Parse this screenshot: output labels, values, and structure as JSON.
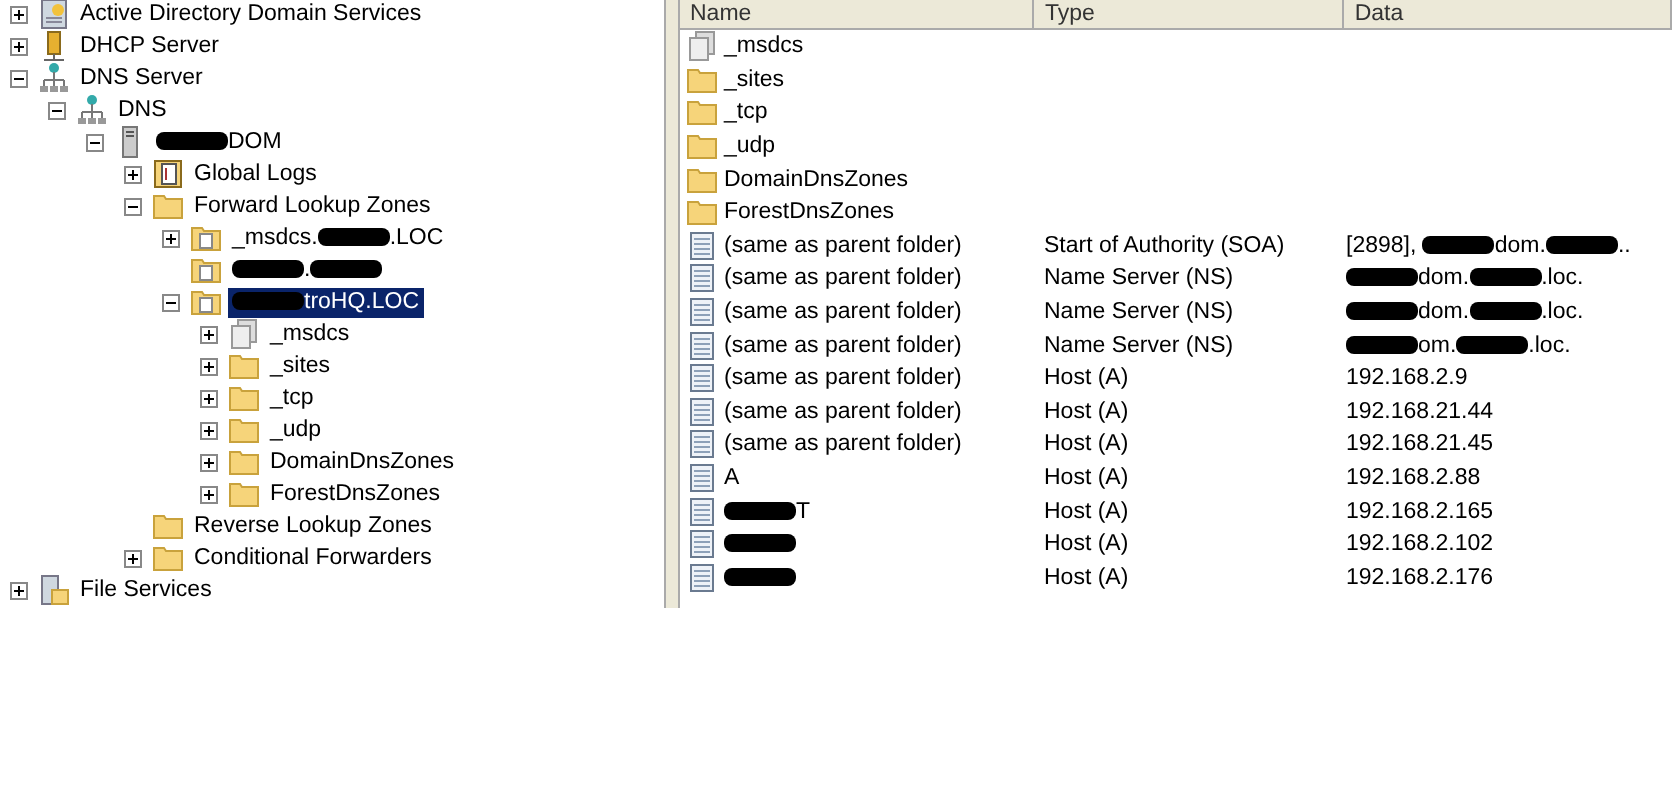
{
  "tree": [
    {
      "label": [
        {
          "text": "Active Directory Domain Services"
        }
      ],
      "kind": "roles",
      "expanded": false,
      "selected": false
    },
    {
      "label": [
        {
          "text": "DHCP Server"
        }
      ],
      "kind": "dhcp",
      "expanded": false,
      "selected": false
    },
    {
      "label": [
        {
          "text": "DNS Server"
        }
      ],
      "kind": "network",
      "expanded": true,
      "selected": false,
      "children": [
        {
          "label": [
            {
              "text": "DNS"
            }
          ],
          "kind": "network",
          "expanded": true,
          "selected": false,
          "children": [
            {
              "label": [
                {
                  "kind": "redaction"
                },
                {
                  "text": "DOM"
                }
              ],
              "kind": "server",
              "expanded": true,
              "selected": false,
              "children": [
                {
                  "label": [
                    {
                      "text": "Global Logs"
                    }
                  ],
                  "kind": "logs",
                  "expanded": false,
                  "selected": false
                },
                {
                  "label": [
                    {
                      "text": "Forward Lookup Zones"
                    }
                  ],
                  "kind": "folder",
                  "expanded": true,
                  "selected": false,
                  "children": [
                    {
                      "label": [
                        {
                          "text": "_msdcs."
                        },
                        {
                          "kind": "redaction"
                        },
                        {
                          "text": ".LOC"
                        }
                      ],
                      "kind": "zone",
                      "expanded": false,
                      "selected": false
                    },
                    {
                      "label": [
                        {
                          "kind": "redaction"
                        },
                        {
                          "text": "."
                        },
                        {
                          "kind": "redaction"
                        }
                      ],
                      "kind": "zone",
                      "selected": false
                    },
                    {
                      "label": [
                        {
                          "kind": "redaction"
                        },
                        {
                          "text": "troHQ.LOC"
                        }
                      ],
                      "kind": "zone",
                      "expanded": true,
                      "selected": true,
                      "children": [
                        {
                          "label": [
                            {
                              "text": "_msdcs"
                            }
                          ],
                          "kind": "delegation",
                          "expanded": false,
                          "selected": false
                        },
                        {
                          "label": [
                            {
                              "text": "_sites"
                            }
                          ],
                          "kind": "folder",
                          "expanded": false,
                          "selected": false
                        },
                        {
                          "label": [
                            {
                              "text": "_tcp"
                            }
                          ],
                          "kind": "folder",
                          "expanded": false,
                          "selected": false
                        },
                        {
                          "label": [
                            {
                              "text": "_udp"
                            }
                          ],
                          "kind": "folder",
                          "expanded": false,
                          "selected": false
                        },
                        {
                          "label": [
                            {
                              "text": "DomainDnsZones"
                            }
                          ],
                          "kind": "folder",
                          "expanded": false,
                          "selected": false
                        },
                        {
                          "label": [
                            {
                              "text": "ForestDnsZones"
                            }
                          ],
                          "kind": "folder",
                          "expanded": false,
                          "selected": false
                        }
                      ]
                    }
                  ]
                },
                {
                  "label": [
                    {
                      "text": "Reverse Lookup Zones"
                    }
                  ],
                  "kind": "folder",
                  "selected": false
                },
                {
                  "label": [
                    {
                      "text": "Conditional Forwarders"
                    }
                  ],
                  "kind": "folder",
                  "expanded": false,
                  "selected": false
                }
              ]
            }
          ]
        }
      ]
    },
    {
      "label": [
        {
          "text": "File Services"
        }
      ],
      "kind": "files",
      "expanded": false,
      "selected": false
    }
  ],
  "list": {
    "columns": [
      "Name",
      "Type",
      "Data"
    ],
    "rows": [
      {
        "kind": "delegation",
        "name": [
          {
            "text": "_msdcs"
          }
        ]
      },
      {
        "kind": "folder",
        "name": [
          {
            "text": "_sites"
          }
        ]
      },
      {
        "kind": "folder",
        "name": [
          {
            "text": "_tcp"
          }
        ]
      },
      {
        "kind": "folder",
        "name": [
          {
            "text": "_udp"
          }
        ]
      },
      {
        "kind": "folder",
        "name": [
          {
            "text": "DomainDnsZones"
          }
        ]
      },
      {
        "kind": "folder",
        "name": [
          {
            "text": "ForestDnsZones"
          }
        ]
      },
      {
        "kind": "record",
        "name": [
          {
            "text": "(same as parent folder)"
          }
        ],
        "type": "Start of Authority (SOA)",
        "data": [
          {
            "text": "[2898], "
          },
          {
            "kind": "redaction"
          },
          {
            "text": "dom."
          },
          {
            "kind": "redaction"
          },
          {
            "text": ".."
          }
        ]
      },
      {
        "kind": "record",
        "name": [
          {
            "text": "(same as parent folder)"
          }
        ],
        "type": "Name Server (NS)",
        "data": [
          {
            "kind": "redaction"
          },
          {
            "text": "dom."
          },
          {
            "kind": "redaction"
          },
          {
            "text": ".loc."
          }
        ]
      },
      {
        "kind": "record",
        "name": [
          {
            "text": "(same as parent folder)"
          }
        ],
        "type": "Name Server (NS)",
        "data": [
          {
            "kind": "redaction"
          },
          {
            "text": "dom."
          },
          {
            "kind": "redaction"
          },
          {
            "text": ".loc."
          }
        ]
      },
      {
        "kind": "record",
        "name": [
          {
            "text": "(same as parent folder)"
          }
        ],
        "type": "Name Server (NS)",
        "data": [
          {
            "kind": "redaction"
          },
          {
            "text": "om."
          },
          {
            "kind": "redaction"
          },
          {
            "text": ".loc."
          }
        ]
      },
      {
        "kind": "record",
        "name": [
          {
            "text": "(same as parent folder)"
          }
        ],
        "type": "Host (A)",
        "data": [
          {
            "text": "192.168.2.9"
          }
        ]
      },
      {
        "kind": "record",
        "name": [
          {
            "text": "(same as parent folder)"
          }
        ],
        "type": "Host (A)",
        "data": [
          {
            "text": "192.168.21.44"
          }
        ]
      },
      {
        "kind": "record",
        "name": [
          {
            "text": "(same as parent folder)"
          }
        ],
        "type": "Host (A)",
        "data": [
          {
            "text": "192.168.21.45"
          }
        ]
      },
      {
        "kind": "record",
        "name": [
          {
            "text": "A"
          }
        ],
        "type": "Host (A)",
        "data": [
          {
            "text": "192.168.2.88"
          }
        ]
      },
      {
        "kind": "record",
        "name": [
          {
            "kind": "redaction"
          },
          {
            "text": "T"
          }
        ],
        "type": "Host (A)",
        "data": [
          {
            "text": "192.168.2.165"
          }
        ]
      },
      {
        "kind": "record",
        "name": [
          {
            "kind": "redaction"
          }
        ],
        "type": "Host (A)",
        "data": [
          {
            "text": "192.168.2.102"
          }
        ]
      },
      {
        "kind": "record",
        "name": [
          {
            "kind": "redaction"
          }
        ],
        "type": "Host (A)",
        "data": [
          {
            "text": "192.168.2.176"
          }
        ]
      }
    ]
  }
}
